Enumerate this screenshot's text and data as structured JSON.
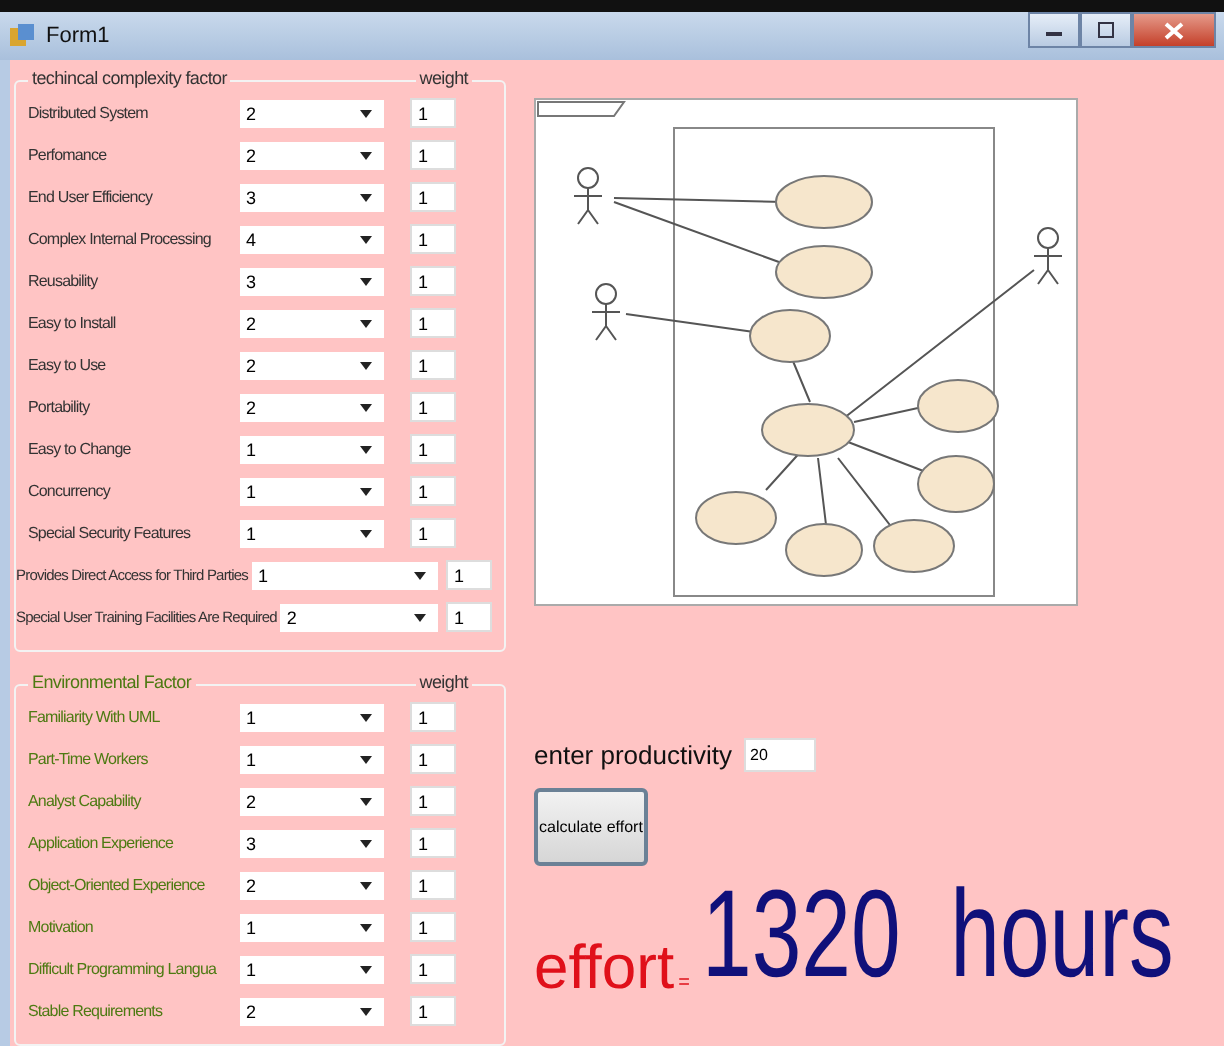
{
  "window": {
    "title": "Form1"
  },
  "technical": {
    "title": "techincal complexity factor",
    "weight_header": "weight",
    "rows": [
      {
        "label": "Distributed System",
        "value": "2",
        "weight": "1",
        "kind": "normal"
      },
      {
        "label": "Perfomance",
        "value": "2",
        "weight": "1",
        "kind": "normal"
      },
      {
        "label": "End User Efficiency",
        "value": "3",
        "weight": "1",
        "kind": "normal"
      },
      {
        "label": "Complex Internal Processing",
        "value": "4",
        "weight": "1",
        "kind": "normal"
      },
      {
        "label": "Reusability",
        "value": "3",
        "weight": "1",
        "kind": "normal"
      },
      {
        "label": "Easy to Install",
        "value": "2",
        "weight": "1",
        "kind": "normal"
      },
      {
        "label": "Easy to Use",
        "value": "2",
        "weight": "1",
        "kind": "normal"
      },
      {
        "label": "Portability",
        "value": "2",
        "weight": "1",
        "kind": "normal"
      },
      {
        "label": "Easy to Change",
        "value": "1",
        "weight": "1",
        "kind": "normal"
      },
      {
        "label": "Concurrency",
        "value": "1",
        "weight": "1",
        "kind": "normal"
      },
      {
        "label": "Special Security Features",
        "value": "1",
        "weight": "1",
        "kind": "normal"
      },
      {
        "label": "Provides Direct Access for Third Parties",
        "value": "1",
        "weight": "1",
        "kind": "wide"
      },
      {
        "label": "Special User Training Facilities Are Required",
        "value": "2",
        "weight": "1",
        "kind": "wide"
      }
    ]
  },
  "environmental": {
    "title": "Environmental Factor",
    "weight_header": "weight",
    "rows": [
      {
        "label": "Familiarity With UML",
        "value": "1",
        "weight": "1"
      },
      {
        "label": "Part-Time Workers",
        "value": "1",
        "weight": "1"
      },
      {
        "label": "Analyst Capability",
        "value": "2",
        "weight": "1"
      },
      {
        "label": "Application Experience",
        "value": "3",
        "weight": "1"
      },
      {
        "label": "Object-Oriented Experience",
        "value": "2",
        "weight": "1"
      },
      {
        "label": "Motivation",
        "value": "1",
        "weight": "1"
      },
      {
        "label": "Difficult Programming Langua",
        "value": "1",
        "weight": "1"
      },
      {
        "label": "Stable Requirements",
        "value": "2",
        "weight": "1"
      }
    ]
  },
  "productivity": {
    "label": "enter productivity",
    "value": "20"
  },
  "calculate_button": "calculate effort",
  "result": {
    "label": "effort",
    "equals": "=",
    "value": "1320",
    "unit": "hours"
  }
}
